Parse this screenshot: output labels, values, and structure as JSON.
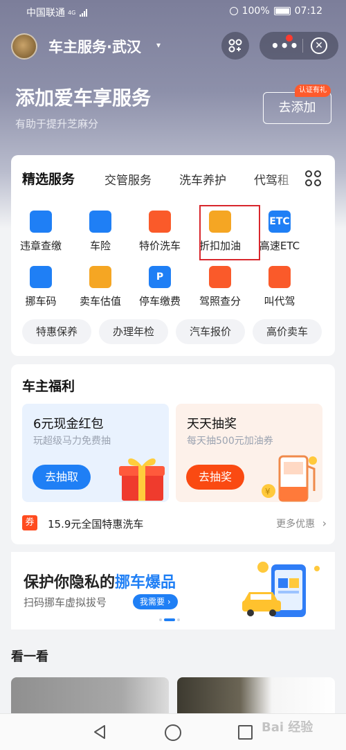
{
  "status_bar": {
    "carrier": "中国联通",
    "network": "4G",
    "battery": "100%",
    "time": "07:12"
  },
  "header": {
    "title": "车主服务·武汉",
    "caret": "▾"
  },
  "hero": {
    "title": "添加爱车享服务",
    "subtitle": "有助于提升芝麻分",
    "add_button": "去添加",
    "verified_badge": "认证有礼"
  },
  "service_tabs": [
    "精选服务",
    "交管服务",
    "洗车养护",
    "代驾租"
  ],
  "services": [
    {
      "label": "违章查缴",
      "icon": "violation-icon",
      "color": "#1f7ff5"
    },
    {
      "label": "车险",
      "icon": "shield-check-icon",
      "color": "#1f7ff5"
    },
    {
      "label": "特价洗车",
      "icon": "car-wash-icon",
      "color": "#fa5a2a"
    },
    {
      "label": "折扣加油",
      "icon": "fuel-pump-icon",
      "color": "#f5a623"
    },
    {
      "label": "高速ETC",
      "icon": "etc-icon",
      "color": "#1f7ff5",
      "glyph": "ETC"
    },
    {
      "label": "挪车码",
      "icon": "qr-car-icon",
      "color": "#1f7ff5"
    },
    {
      "label": "卖车估值",
      "icon": "calculator-icon",
      "color": "#f5a623"
    },
    {
      "label": "停车缴费",
      "icon": "parking-icon",
      "color": "#1f7ff5",
      "glyph": "P"
    },
    {
      "label": "驾照查分",
      "icon": "license-search-icon",
      "color": "#fa5a2a"
    },
    {
      "label": "叫代驾",
      "icon": "driver-icon",
      "color": "#fa5a2a"
    }
  ],
  "quick_pills": [
    "特惠保养",
    "办理年检",
    "汽车报价",
    "高价卖车"
  ],
  "welfare": {
    "title": "车主福利",
    "cards": [
      {
        "title": "6元现金红包",
        "subtitle": "玩超级马力免费抽",
        "button": "去抽取"
      },
      {
        "title": "天天抽奖",
        "subtitle": "每天抽500元加油券",
        "button": "去抽奖"
      }
    ],
    "coupon_tag": "券",
    "coupon_text": "15.9元全国特惠洗车",
    "more_deals": "更多优惠"
  },
  "banner": {
    "title_prefix": "保护你隐私的",
    "title_highlight": "挪车爆品",
    "subtitle": "扫码挪车虚拟拔号",
    "button": "我需要"
  },
  "section_look": "看一看",
  "watermark": "Bai 经验"
}
